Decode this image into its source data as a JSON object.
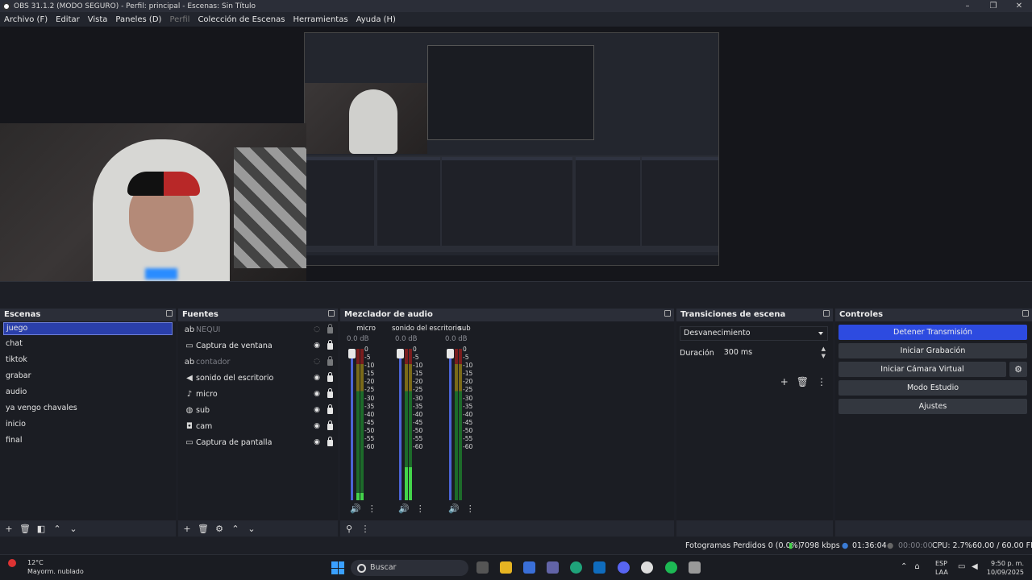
{
  "window": {
    "title": "OBS 31.1.2 (MODO SEGURO) - Perfil: principal - Escenas: Sin Título"
  },
  "menu": [
    "Archivo (F)",
    "Editar",
    "Vista",
    "Paneles (D)",
    "Perfil",
    "Colección de Escenas",
    "Herramientas",
    "Ayuda (H)"
  ],
  "scenes": {
    "title": "Escenas",
    "items": [
      "juego",
      "chat",
      "tiktok",
      "grabar",
      "audio",
      "ya vengo chavales",
      "inicio",
      "final"
    ],
    "selected": "juego"
  },
  "sources": {
    "title": "Fuentes",
    "items": [
      {
        "label": "NEQUI",
        "icon": "text-icon",
        "visible": false
      },
      {
        "label": "Captura de ventana",
        "icon": "window-icon",
        "visible": true
      },
      {
        "label": "contador",
        "icon": "text-icon",
        "visible": false
      },
      {
        "label": "sonido del escritorio",
        "icon": "speaker-icon",
        "visible": true
      },
      {
        "label": "micro",
        "icon": "microphone-icon",
        "visible": true
      },
      {
        "label": "sub",
        "icon": "browser-icon",
        "visible": true
      },
      {
        "label": "cam",
        "icon": "camera-icon",
        "visible": true
      },
      {
        "label": "Captura de pantalla",
        "icon": "monitor-icon",
        "visible": true
      }
    ]
  },
  "mixer": {
    "title": "Mezclador de audio",
    "scale": [
      "0",
      "-5",
      "-10",
      "-15",
      "-20",
      "-25",
      "-30",
      "-35",
      "-40",
      "-45",
      "-50",
      "-55",
      "-60"
    ],
    "channels": [
      {
        "name": "micro",
        "db": "0.0 dB",
        "level": 0.05
      },
      {
        "name": "sonido del escritorio",
        "db": "0.0 dB",
        "level": 0.22
      },
      {
        "name": "sub",
        "db": "0.0 dB",
        "level": 0.0
      }
    ]
  },
  "transitions": {
    "title": "Transiciones de escena",
    "selected": "Desvanecimiento",
    "duration_label": "Duración",
    "duration_value": "300 ms"
  },
  "controls": {
    "title": "Controles",
    "stop_stream": "Detener Transmisión",
    "start_recording": "Iniciar Grabación",
    "start_virtual_cam": "Iniciar Cámara Virtual",
    "studio_mode": "Modo Estudio",
    "settings": "Ajustes"
  },
  "status": {
    "dropped_frames": "Fotogramas Perdidos 0 (0.0%)",
    "bitrate": "7098 kbps",
    "stream_time": "01:36:04",
    "record_time": "00:00:00",
    "cpu": "CPU: 2.7%",
    "fps": "60.00 / 60.00 FPS"
  },
  "taskbar": {
    "weather_temp": "12°C",
    "weather_desc": "Mayorm. nublado",
    "search_placeholder": "Buscar",
    "lang_top": "ESP",
    "lang_bottom": "LAA",
    "time": "9:50 p. m.",
    "date": "10/09/2025"
  },
  "colors": {
    "accent": "#2d4be0",
    "selection": "#2a3faa",
    "panel": "#1b1d23"
  }
}
